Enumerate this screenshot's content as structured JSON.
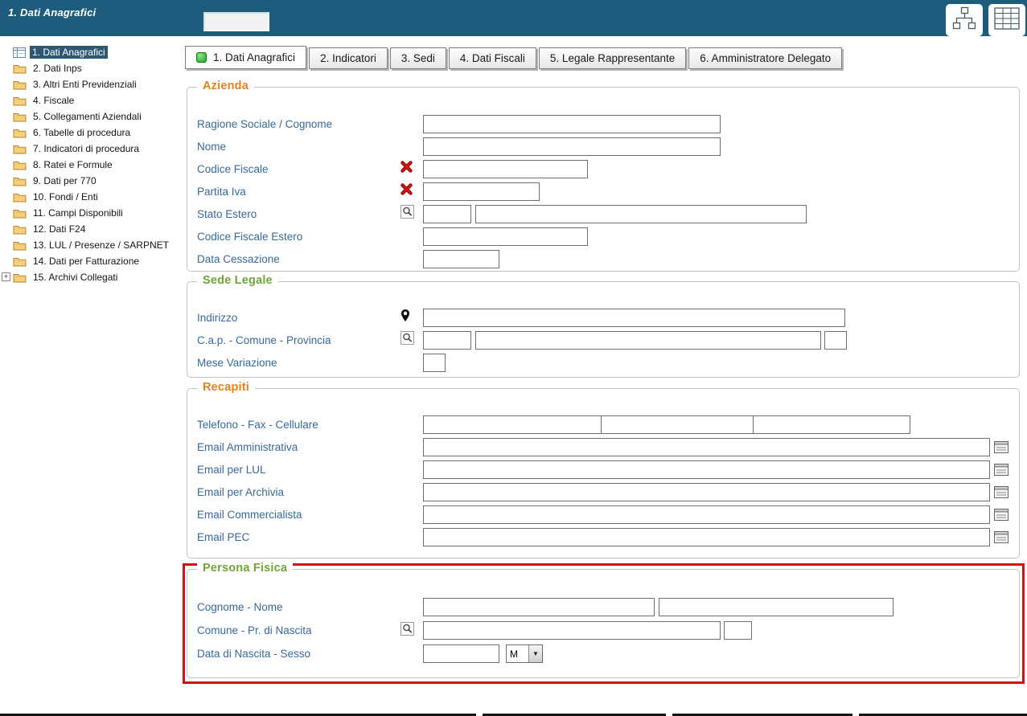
{
  "header": {
    "title": "1. Dati Anagrafici",
    "quick_input_value": ""
  },
  "sidebar": {
    "expander_glyph": "+",
    "items": [
      {
        "label": "1. Dati Anagrafici",
        "icon": "form-icon",
        "selected": true
      },
      {
        "label": "2. Dati Inps",
        "icon": "folder-icon",
        "selected": false
      },
      {
        "label": "3. Altri Enti Previdenziali",
        "icon": "folder-icon",
        "selected": false
      },
      {
        "label": "4. Fiscale",
        "icon": "folder-icon",
        "selected": false
      },
      {
        "label": "5. Collegamenti Aziendali",
        "icon": "folder-icon",
        "selected": false
      },
      {
        "label": "6. Tabelle di procedura",
        "icon": "folder-icon",
        "selected": false
      },
      {
        "label": "7. Indicatori di procedura",
        "icon": "folder-icon",
        "selected": false
      },
      {
        "label": "8. Ratei e Formule",
        "icon": "folder-icon",
        "selected": false
      },
      {
        "label": "9. Dati per 770",
        "icon": "folder-icon",
        "selected": false
      },
      {
        "label": "10. Fondi / Enti",
        "icon": "folder-icon",
        "selected": false
      },
      {
        "label": "11. Campi Disponibili",
        "icon": "folder-icon",
        "selected": false
      },
      {
        "label": "12. Dati F24",
        "icon": "folder-icon",
        "selected": false
      },
      {
        "label": "13. LUL / Presenze / SARPNET",
        "icon": "folder-icon",
        "selected": false
      },
      {
        "label": "14. Dati per Fatturazione",
        "icon": "folder-icon",
        "selected": false
      },
      {
        "label": "15. Archivi Collegati",
        "icon": "folder-icon",
        "selected": false,
        "expandable": true
      }
    ]
  },
  "tabs": [
    {
      "label": "1. Dati Anagrafici",
      "active": true
    },
    {
      "label": "2. Indicatori",
      "active": false
    },
    {
      "label": "3. Sedi",
      "active": false
    },
    {
      "label": "4. Dati Fiscali",
      "active": false
    },
    {
      "label": "5. Legale Rappresentante",
      "active": false
    },
    {
      "label": "6. Amministratore Delegato",
      "active": false
    }
  ],
  "sections": {
    "azienda": {
      "title": "Azienda",
      "fields": {
        "ragione_sociale": {
          "label": "Ragione Sociale / Cognome",
          "value": ""
        },
        "nome": {
          "label": "Nome",
          "value": ""
        },
        "codice_fiscale": {
          "label": "Codice Fiscale",
          "icon": "red-x-icon",
          "value": ""
        },
        "partita_iva": {
          "label": "Partita Iva",
          "icon": "red-x-icon",
          "value": ""
        },
        "stato_estero": {
          "label": "Stato Estero",
          "icon": "search-icon",
          "code_value": "",
          "desc_value": ""
        },
        "codice_fiscale_estero": {
          "label": "Codice Fiscale Estero",
          "value": ""
        },
        "data_cessazione": {
          "label": "Data Cessazione",
          "value": ""
        }
      }
    },
    "sede_legale": {
      "title": "Sede Legale",
      "fields": {
        "indirizzo": {
          "label": "Indirizzo",
          "icon": "location-pin-icon",
          "value": ""
        },
        "cap_comune_provincia": {
          "label": "C.a.p. - Comune - Provincia",
          "icon": "search-icon",
          "cap_value": "",
          "comune_value": "",
          "provincia_value": ""
        },
        "mese_variazione": {
          "label": "Mese Variazione",
          "value": ""
        }
      }
    },
    "recapiti": {
      "title": "Recapiti",
      "fields": {
        "telefono_fax_cellulare": {
          "label": "Telefono - Fax - Cellulare",
          "telefono_value": "",
          "fax_value": "",
          "cellulare_value": ""
        },
        "email_amministrativa": {
          "label": "Email Amministrativa",
          "value": ""
        },
        "email_per_lul": {
          "label": "Email per LUL",
          "value": ""
        },
        "email_per_archivia": {
          "label": "Email per Archivia",
          "value": ""
        },
        "email_commercialista": {
          "label": "Email Commercialista",
          "value": ""
        },
        "email_pec": {
          "label": "Email PEC",
          "value": ""
        }
      }
    },
    "persona_fisica": {
      "title": "Persona Fisica",
      "highlighted": true,
      "fields": {
        "cognome_nome": {
          "label": "Cognome - Nome",
          "cognome_value": "",
          "nome_value": ""
        },
        "comune_pr_nascita": {
          "label": "Comune - Pr. di Nascita",
          "icon": "search-icon",
          "comune_value": "",
          "pr_value": ""
        },
        "data_nascita_sesso": {
          "label": "Data di Nascita - Sesso",
          "data_value": "",
          "sesso_value": "M",
          "sesso_options": [
            "M"
          ]
        }
      }
    }
  },
  "colors": {
    "header_bg": "#1e5c7d",
    "label_blue": "#36699e",
    "legend_orange": "#e8811c",
    "legend_green": "#6fa636",
    "highlight_red": "#d01414",
    "tab_active_indicator": "#1fa51f",
    "selected_tree_bg": "#2d5871"
  }
}
